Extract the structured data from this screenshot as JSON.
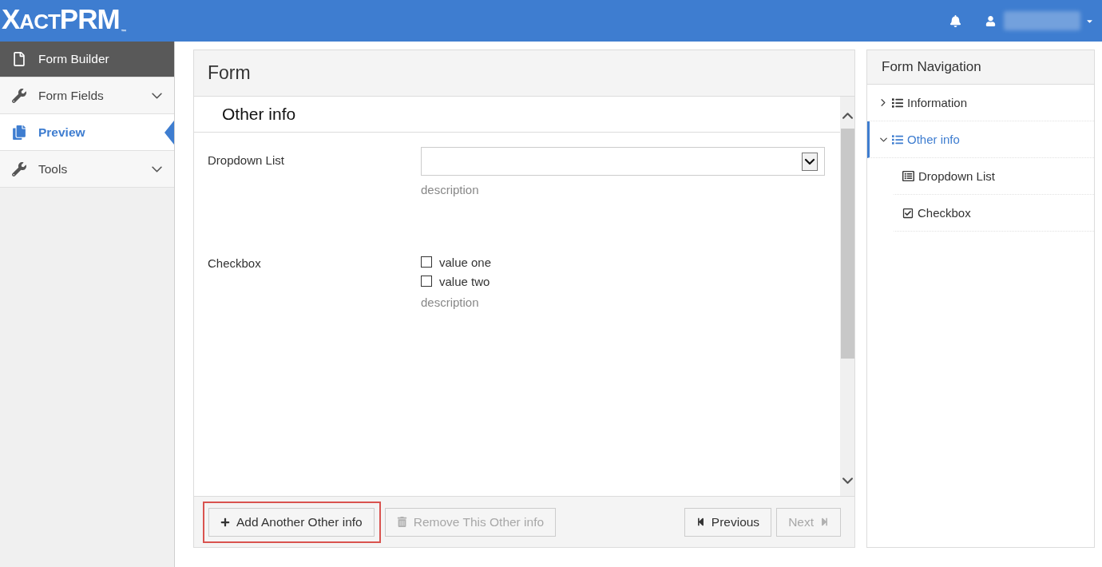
{
  "header": {
    "logo": [
      "X",
      "ACT",
      "PRM"
    ],
    "trademark": "™"
  },
  "sidebar": {
    "items": [
      {
        "label": "Form Builder",
        "kind": "heading",
        "selected": false
      },
      {
        "label": "Form Fields",
        "kind": "group",
        "expanded": false,
        "selected": false
      },
      {
        "label": "Preview",
        "kind": "page",
        "selected": true
      },
      {
        "label": "Tools",
        "kind": "group",
        "expanded": false,
        "selected": false
      }
    ]
  },
  "form": {
    "title": "Form",
    "section": {
      "title": "Other info",
      "fields": [
        {
          "kind": "dropdown",
          "label": "Dropdown List",
          "description": "description"
        },
        {
          "kind": "checkboxes",
          "label": "Checkbox",
          "options": [
            {
              "label": "value one",
              "checked": false
            },
            {
              "label": "value two",
              "checked": false
            }
          ],
          "description": "description"
        }
      ]
    },
    "footer": {
      "actions": [
        {
          "kind": "add",
          "label": "Add Another Other info",
          "disabled": false,
          "highlighted": true
        },
        {
          "kind": "remove",
          "label": "Remove This Other info",
          "disabled": true,
          "highlighted": false
        }
      ],
      "pager": [
        {
          "kind": "previous",
          "label": "Previous",
          "disabled": false
        },
        {
          "kind": "next",
          "label": "Next",
          "disabled": true
        }
      ]
    }
  },
  "navigation": {
    "title": "Form Navigation",
    "items": [
      {
        "label": "Information",
        "kind": "section",
        "expanded": false,
        "selected": false
      },
      {
        "label": "Other info",
        "kind": "section",
        "expanded": true,
        "selected": true,
        "children": [
          {
            "label": "Dropdown List",
            "kind": "dropdown",
            "selected": false
          },
          {
            "label": "Checkbox",
            "kind": "checkbox",
            "selected": false
          }
        ]
      }
    ]
  }
}
